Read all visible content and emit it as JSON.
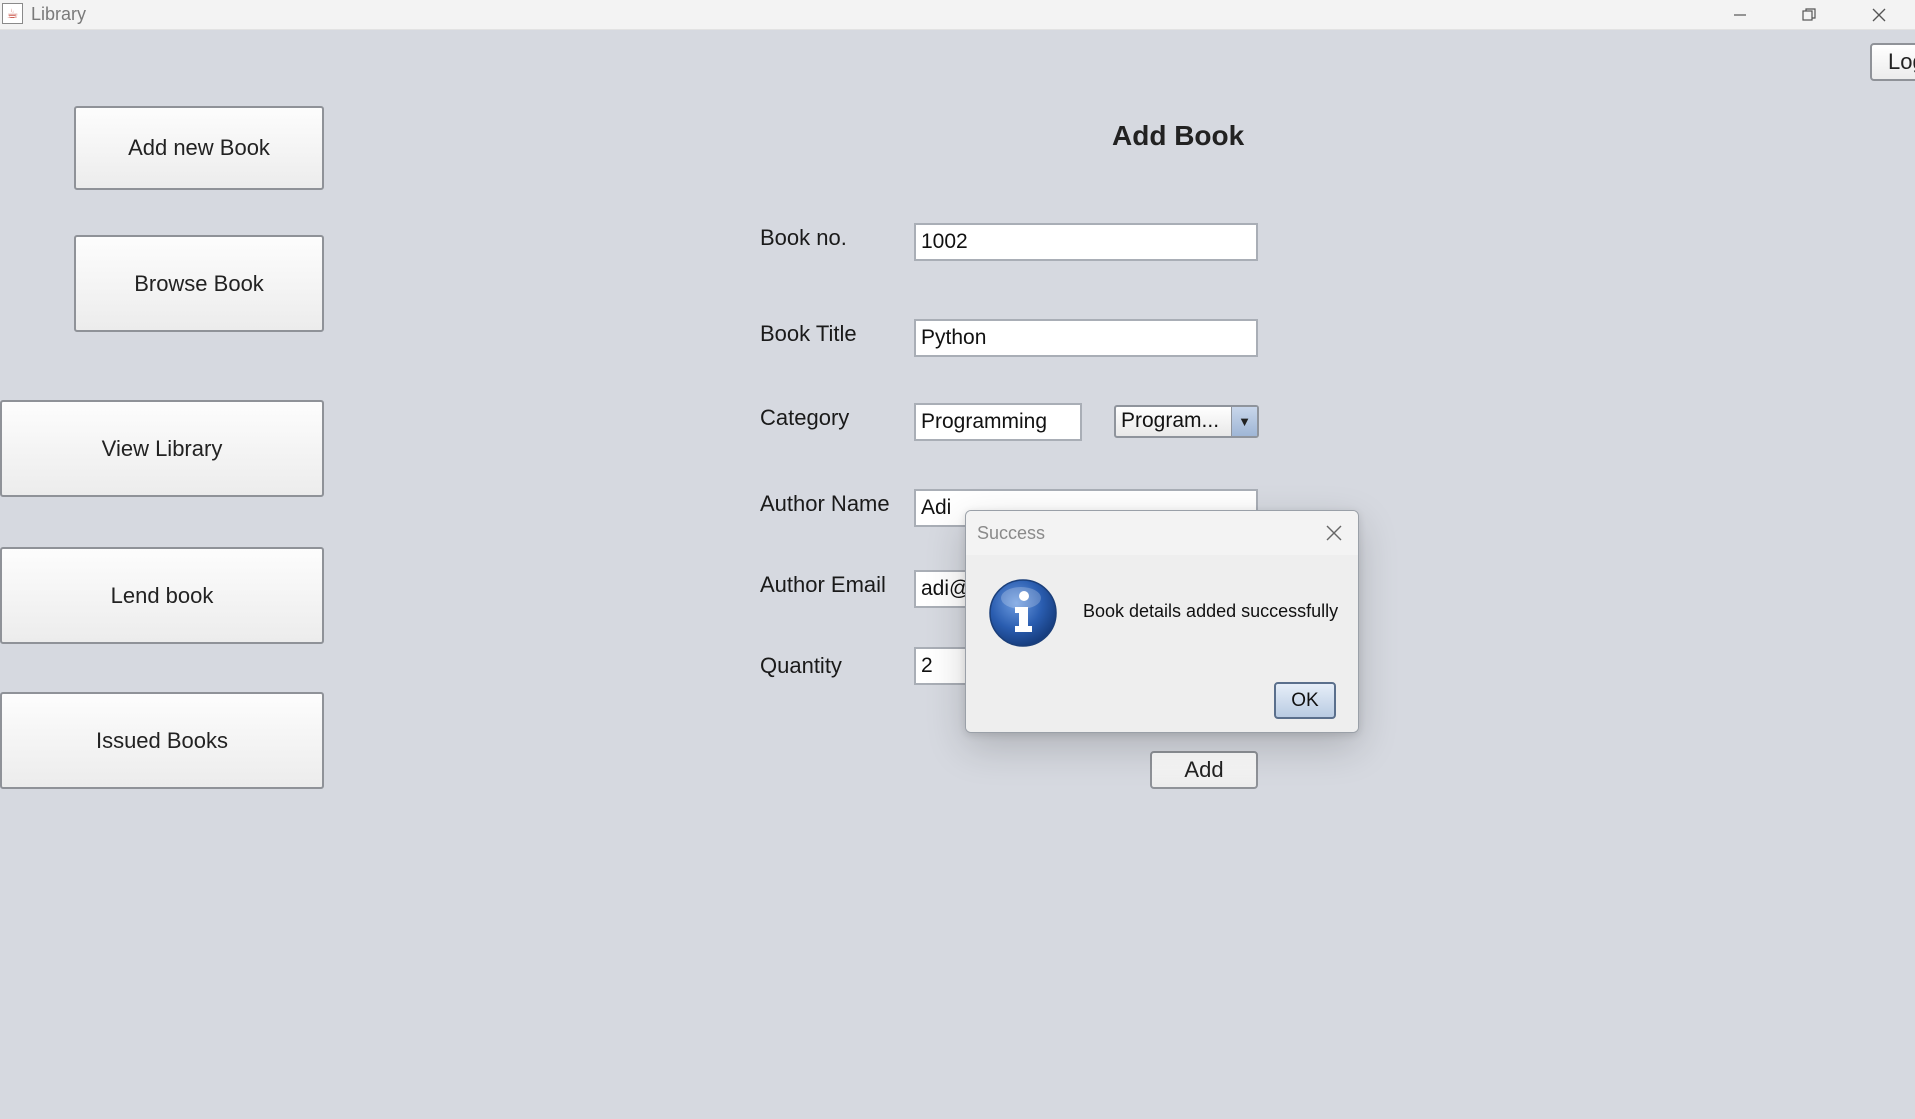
{
  "window": {
    "title": "Library",
    "app_icon": "java-cup-icon",
    "controls": [
      "minimize-icon",
      "maximize-icon",
      "close-icon"
    ]
  },
  "header": {
    "logout_label": "Log"
  },
  "sidebar": {
    "items": [
      {
        "label": "Add new Book"
      },
      {
        "label": "Browse Book"
      },
      {
        "label": "View Library"
      },
      {
        "label": "Lend book"
      },
      {
        "label": "Issued Books"
      }
    ]
  },
  "form": {
    "heading": "Add Book",
    "book_no": {
      "label": "Book no.",
      "value": "1002"
    },
    "book_title": {
      "label": "Book Title",
      "value": "Python"
    },
    "category": {
      "label": "Category",
      "value": "Programming",
      "dropdown_selected": "Program..."
    },
    "author_name": {
      "label": "Author Name",
      "value": "Adi"
    },
    "author_email": {
      "label": "Author Email",
      "value": "adi@"
    },
    "quantity": {
      "label": "Quantity",
      "value": "2"
    },
    "add_label": "Add"
  },
  "dialog": {
    "title": "Success",
    "message": "Book details added successfully",
    "ok_label": "OK",
    "icon": "info-icon"
  },
  "colors": {
    "background": "#d6d9e0",
    "dialog_accent": "#2a5db0"
  }
}
